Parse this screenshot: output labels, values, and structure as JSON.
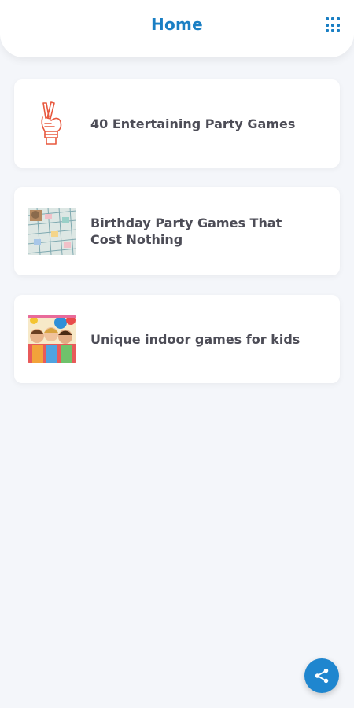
{
  "header": {
    "title": "Home",
    "menu_icon": "grid-icon",
    "accent_color": "#1a7fc4"
  },
  "cards": [
    {
      "title": "40 Entertaining Party Games",
      "icon": "crossed-fingers-icon"
    },
    {
      "title": "Birthday Party Games That Cost Nothing",
      "icon": "board-game-photo"
    },
    {
      "title": "Unique indoor games for kids",
      "icon": "kids-party-photo"
    }
  ],
  "fab": {
    "icon": "share-icon",
    "color": "#1f86cf"
  }
}
